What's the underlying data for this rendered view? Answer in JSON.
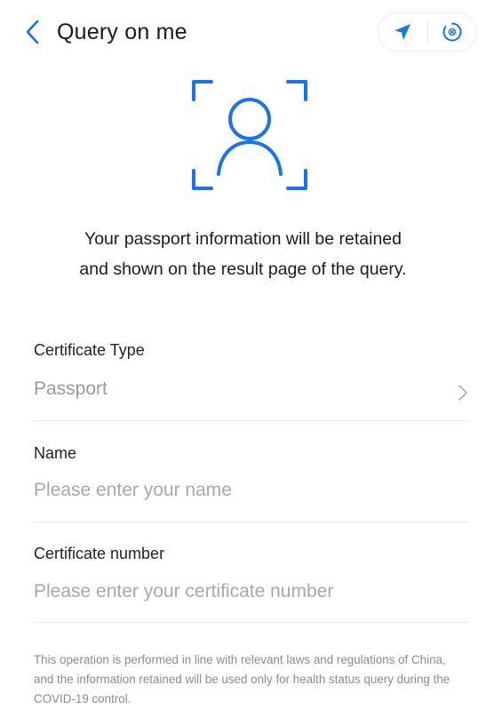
{
  "header": {
    "title": "Query on me",
    "accent_color": "#1a73e8"
  },
  "notice": {
    "line1": "Your passport information will be retained",
    "line2": "and shown on the result page of the query."
  },
  "form": {
    "certificate_type": {
      "label": "Certificate Type",
      "value": "Passport"
    },
    "name": {
      "label": "Name",
      "placeholder": "Please enter your name"
    },
    "certificate_number": {
      "label": "Certificate number",
      "placeholder": "Please enter your certificate number"
    }
  },
  "disclaimer": "This operation is performed in line with relevant laws and regulations of China, and the information retained will be used only for health status query during the COVID-19 control.",
  "icons": {
    "back": "chevron-left-icon",
    "location": "location-arrow-icon",
    "close": "close-circle-icon",
    "face": "face-scan-icon",
    "select": "chevron-right-icon"
  }
}
